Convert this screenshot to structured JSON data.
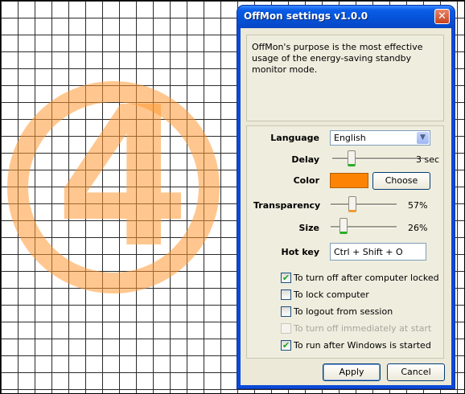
{
  "window": {
    "title": "OffMon settings v1.0.0",
    "close_symbol": "✕"
  },
  "description": "OffMon's purpose is the most effective usage of the energy-saving standby monitor mode.",
  "overlay": {
    "digit": "4",
    "color": "#ff9933"
  },
  "settings": {
    "language": {
      "label": "Language",
      "value": "English"
    },
    "delay": {
      "label": "Delay",
      "value_text": "3 sec"
    },
    "color": {
      "label": "Color",
      "swatch": "#fc8304",
      "choose_label": "Choose"
    },
    "transparency": {
      "label": "Transparency",
      "value_text": "57%"
    },
    "size": {
      "label": "Size",
      "value_text": "26%"
    },
    "hotkey": {
      "label": "Hot key",
      "value": "Ctrl + Shift + O"
    }
  },
  "options": [
    {
      "label": "To turn off after computer locked",
      "checked": true,
      "enabled": true
    },
    {
      "label": "To lock computer",
      "checked": false,
      "enabled": true
    },
    {
      "label": "To logout from session",
      "checked": false,
      "enabled": true
    },
    {
      "label": "To turn off immediately at start",
      "checked": false,
      "enabled": false
    },
    {
      "label": "To run after Windows is started",
      "checked": true,
      "enabled": true
    }
  ],
  "buttons": {
    "apply": "Apply",
    "cancel": "Cancel"
  }
}
